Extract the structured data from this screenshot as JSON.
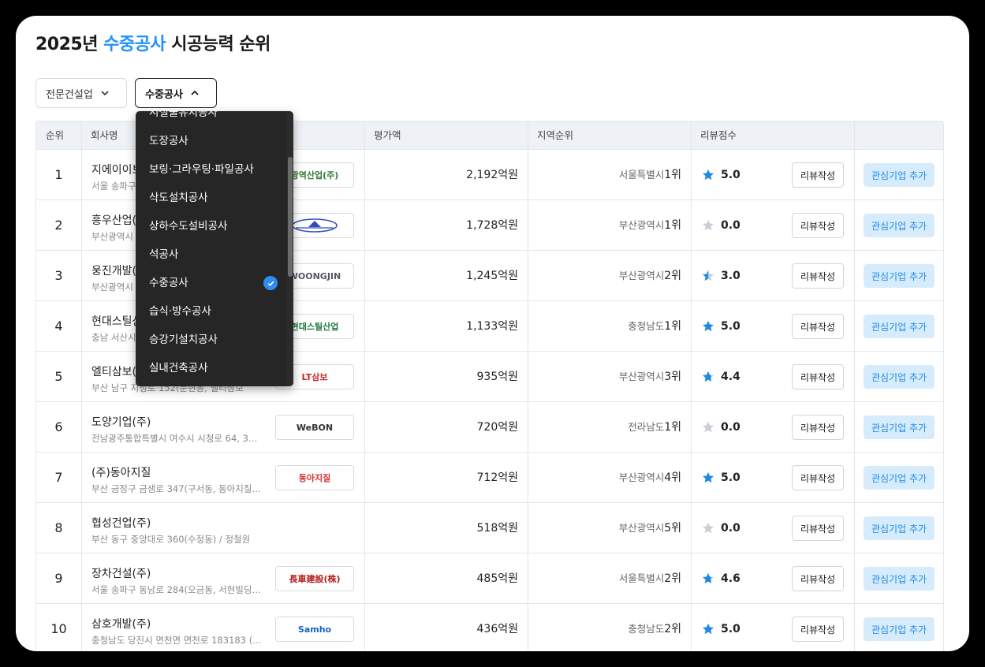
{
  "title": {
    "year": "2025년",
    "accent": "수중공사",
    "rest": "시공능력 순위"
  },
  "filters": {
    "category": "전문건설업",
    "subcategory": "수중공사"
  },
  "colors": {
    "accent": "#1e90ff",
    "star_filled": "#1e88e5",
    "star_empty": "#c9ced6",
    "interest_bg": "#d6ecfd"
  },
  "table": {
    "headers": {
      "rank": "순위",
      "company": "회사명",
      "amount": "평가액",
      "region": "지역순위",
      "score": "리뷰점수"
    },
    "review_label": "리뷰작성",
    "interest_label": "관심기업 추가",
    "rows": [
      {
        "rank": "1",
        "company": "지에이이브",
        "address": "서울 송파구",
        "logo": "광역산업(주)",
        "amount": "2,192억원",
        "region": "서울특별시",
        "region_rank": "1위",
        "score": "5.0",
        "star": "full"
      },
      {
        "rank": "2",
        "company": "흥우산업(",
        "address": "부산광역시",
        "logo": "",
        "amount": "1,728억원",
        "region": "부산광역시",
        "region_rank": "1위",
        "score": "0.0",
        "star": "empty"
      },
      {
        "rank": "3",
        "company": "웅진개발(",
        "address": "부산광역시",
        "logo": "WOONGJIN",
        "amount": "1,245억원",
        "region": "부산광역시",
        "region_rank": "2위",
        "score": "3.0",
        "star": "half"
      },
      {
        "rank": "4",
        "company": "현대스틸산",
        "address": "충남 서산시",
        "logo": "현대스틸산업",
        "amount": "1,133억원",
        "region": "충청남도",
        "region_rank": "1위",
        "score": "5.0",
        "star": "full"
      },
      {
        "rank": "5",
        "company": "엘티삼보(",
        "address": "부산 남구 지정로 152(문현동, 엘티삼보",
        "logo": "LT삼보",
        "amount": "935억원",
        "region": "부산광역시",
        "region_rank": "3위",
        "score": "4.4",
        "star": "mostly"
      },
      {
        "rank": "6",
        "company": "도양기업(주)",
        "address": "전남광주통합특별시 여수시 시청로 64, 3…",
        "logo": "WeBON",
        "amount": "720억원",
        "region": "전라남도",
        "region_rank": "1위",
        "score": "0.0",
        "star": "empty"
      },
      {
        "rank": "7",
        "company": "(주)동아지질",
        "address": "부산 금정구 금샘로 347(구서동, 동아지질…",
        "logo": "동아지질",
        "amount": "712억원",
        "region": "부산광역시",
        "region_rank": "4위",
        "score": "5.0",
        "star": "full"
      },
      {
        "rank": "8",
        "company": "협성건업(주)",
        "address": "부산 동구 중앙대로 360(수정동) / 정철원",
        "logo": "",
        "amount": "518억원",
        "region": "부산광역시",
        "region_rank": "5위",
        "score": "0.0",
        "star": "empty"
      },
      {
        "rank": "9",
        "company": "장차건설(주)",
        "address": "서울 송파구 동남로 284(오금동, 서현빌딩…",
        "logo": "長車建設(株)",
        "amount": "485억원",
        "region": "서울특별시",
        "region_rank": "2위",
        "score": "4.6",
        "star": "mostly"
      },
      {
        "rank": "10",
        "company": "삼호개발(주)",
        "address": "충청남도 당진시 면천면 면천로 183183 (…",
        "logo": "Samho",
        "amount": "436억원",
        "region": "충청남도",
        "region_rank": "2위",
        "score": "5.0",
        "star": "full"
      }
    ]
  },
  "dropdown": {
    "items": [
      {
        "label": "시설물유지공사",
        "selected": false
      },
      {
        "label": "도장공사",
        "selected": false
      },
      {
        "label": "보링·그라우팅·파일공사",
        "selected": false
      },
      {
        "label": "삭도설치공사",
        "selected": false
      },
      {
        "label": "상하수도설비공사",
        "selected": false
      },
      {
        "label": "석공사",
        "selected": false
      },
      {
        "label": "수중공사",
        "selected": true
      },
      {
        "label": "습식·방수공사",
        "selected": false
      },
      {
        "label": "승강기설치공사",
        "selected": false
      },
      {
        "label": "실내건축공사",
        "selected": false
      }
    ]
  }
}
